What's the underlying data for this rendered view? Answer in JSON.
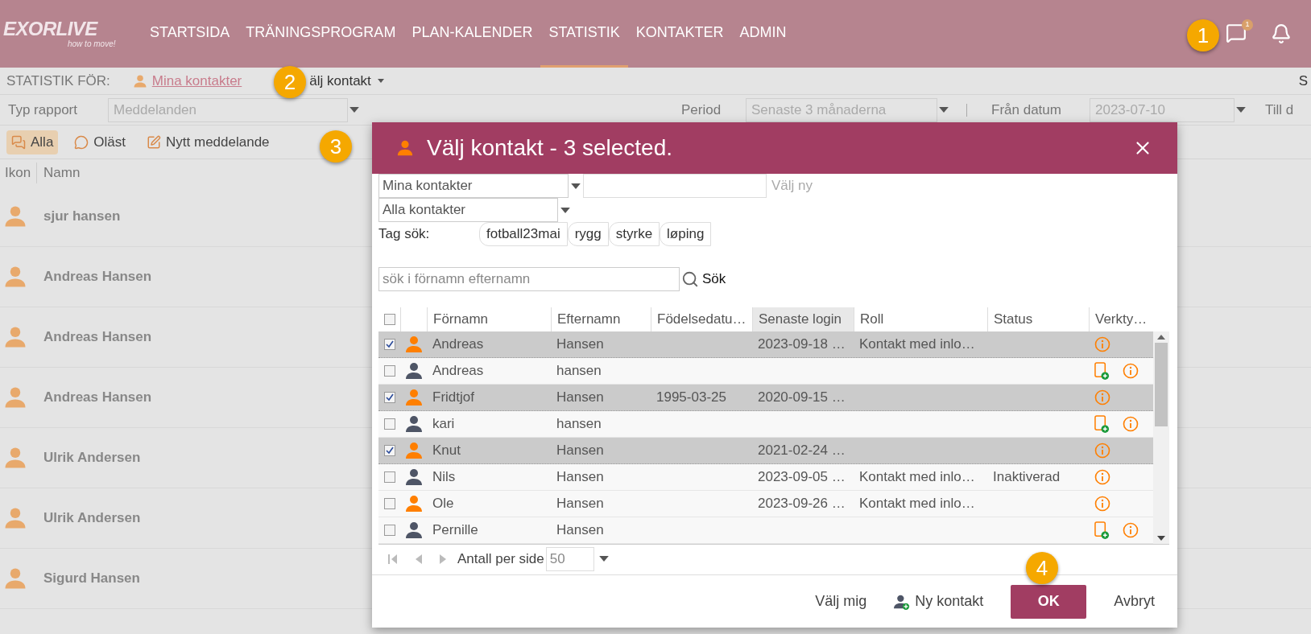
{
  "logo": {
    "name": "EXORLIVE",
    "tagline": "how to move!"
  },
  "nav": [
    {
      "label": "STARTSIDA",
      "selected": false
    },
    {
      "label": "TRÄNINGSPROGRAM",
      "selected": false
    },
    {
      "label": "PLAN-KALENDER",
      "selected": false
    },
    {
      "label": "STATISTIK",
      "selected": true
    },
    {
      "label": "KONTAKTER",
      "selected": false
    },
    {
      "label": "ADMIN",
      "selected": false
    }
  ],
  "chat_badge": "1",
  "stats_for": {
    "label": "STATISTIK FÖR:",
    "link": "Mina kontakter",
    "select": "älj kontakt",
    "right_cut": "S"
  },
  "filters": {
    "report_label": "Typ rapport",
    "report_value": "Meddelanden",
    "period_label": "Period",
    "period_value": "Senaste 3 månaderna",
    "from_label": "Från datum",
    "from_value": "2023-07-10",
    "to_label": "Till d"
  },
  "toolbar": [
    {
      "label": "Alla",
      "selected": true,
      "kind": "all"
    },
    {
      "label": "Oläst",
      "selected": false,
      "kind": "unread"
    },
    {
      "label": "Nytt meddelande",
      "selected": false,
      "kind": "new"
    }
  ],
  "list": {
    "columns": [
      "Ikon",
      "Namn"
    ],
    "rows": [
      "sjur hansen",
      "Andreas Hansen",
      "Andreas Hansen",
      "Andreas Hansen",
      "Ulrik Andersen",
      "Ulrik Andersen",
      "Sigurd Hansen"
    ]
  },
  "dialog": {
    "title": "Välj kontakt - 3 selected.",
    "group_select": "Mina kontakter",
    "new_label": "Välj ny",
    "filter_select": "Alla kontakter",
    "tag_label": "Tag sök:",
    "tags": [
      "fotball23mai",
      "rygg",
      "styrke",
      "løping"
    ],
    "search_placeholder": "sök i förnamn efternamn",
    "search_button": "Sök",
    "all_checked": false,
    "columns": [
      "Förnamn",
      "Efternamn",
      "Födelsedatu…",
      "Senaste login",
      "Roll",
      "Status",
      "Verkty…"
    ],
    "rows": [
      {
        "checked": true,
        "color": "#ff7f00",
        "first": "Andreas",
        "last": "Hansen",
        "birth": "",
        "login": "2023-09-18 …",
        "role": "Kontakt med inlo…",
        "status": "",
        "invite": false
      },
      {
        "checked": false,
        "color": "#4e5566",
        "first": "Andreas",
        "last": "hansen",
        "birth": "",
        "login": "",
        "role": "",
        "status": "",
        "invite": true
      },
      {
        "checked": true,
        "color": "#ff7f00",
        "first": "Fridtjof",
        "last": "Hansen",
        "birth": "1995-03-25",
        "login": "2020-09-15 …",
        "role": "",
        "status": "",
        "invite": false
      },
      {
        "checked": false,
        "color": "#4e5566",
        "first": "kari",
        "last": "hansen",
        "birth": "",
        "login": "",
        "role": "",
        "status": "",
        "invite": true
      },
      {
        "checked": true,
        "color": "#ff7f00",
        "first": "Knut",
        "last": "Hansen",
        "birth": "",
        "login": "2021-02-24 …",
        "role": "",
        "status": "",
        "invite": false
      },
      {
        "checked": false,
        "color": "#4e5566",
        "first": "Nils",
        "last": "Hansen",
        "birth": "",
        "login": "2023-09-05 …",
        "role": "Kontakt med inlo…",
        "status": "Inaktiverad",
        "invite": false
      },
      {
        "checked": false,
        "color": "#ff7f00",
        "first": "Ole",
        "last": "Hansen",
        "birth": "",
        "login": "2023-09-26 …",
        "role": "Kontakt med inlo…",
        "status": "",
        "invite": false
      },
      {
        "checked": false,
        "color": "#4e5566",
        "first": "Pernille",
        "last": "Hansen",
        "birth": "",
        "login": "",
        "role": "",
        "status": "",
        "invite": true
      }
    ],
    "per_page_label": "Antall per side",
    "per_page": "50",
    "buttons": [
      {
        "label": "Välj mig",
        "kind": "plain"
      },
      {
        "label": "Ny kontakt",
        "kind": "icon"
      },
      {
        "label": "OK",
        "kind": "primary"
      },
      {
        "label": "Avbryt",
        "kind": "plain"
      }
    ]
  },
  "callouts": [
    "1",
    "2",
    "3",
    "4"
  ]
}
